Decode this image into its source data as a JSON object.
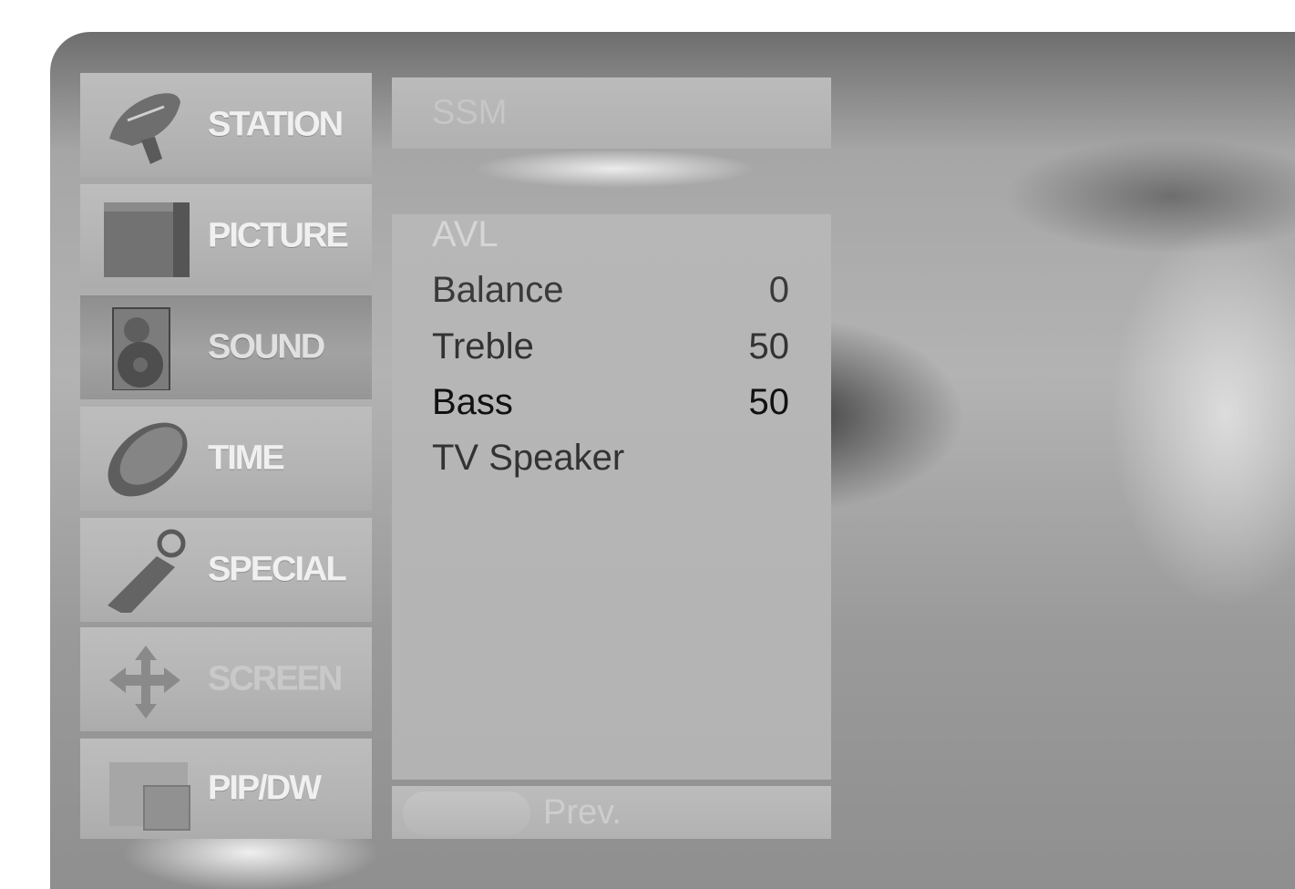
{
  "sidebar": {
    "items": [
      {
        "label": "STATION",
        "icon": "satellite-dish-icon",
        "active": false
      },
      {
        "label": "PICTURE",
        "icon": "tv-screen-icon",
        "active": false
      },
      {
        "label": "SOUND",
        "icon": "speaker-icon",
        "active": true
      },
      {
        "label": "TIME",
        "icon": "clock-disc-icon",
        "active": false
      },
      {
        "label": "SPECIAL",
        "icon": "key-tag-icon",
        "active": false
      },
      {
        "label": "SCREEN",
        "icon": "move-arrows-icon",
        "active": false,
        "dimmed": true
      },
      {
        "label": "PIP/DW",
        "icon": "pip-window-icon",
        "active": false
      }
    ]
  },
  "top_bar": {
    "label": "SSM"
  },
  "sound_menu": {
    "items": [
      {
        "label": "AVL",
        "value": "",
        "state": "disabled"
      },
      {
        "label": "Balance",
        "value": "0",
        "state": "normal"
      },
      {
        "label": "Treble",
        "value": "50",
        "state": "normal"
      },
      {
        "label": "Bass",
        "value": "50",
        "state": "selected"
      },
      {
        "label": "TV Speaker",
        "value": "",
        "state": "normal"
      }
    ]
  },
  "footer": {
    "prev_label": "Prev."
  },
  "colors": {
    "panel": "#b5b5b5",
    "active_item": "#9a9a9a",
    "menu_text": "#333333",
    "label_text": "#f0f0f0"
  }
}
